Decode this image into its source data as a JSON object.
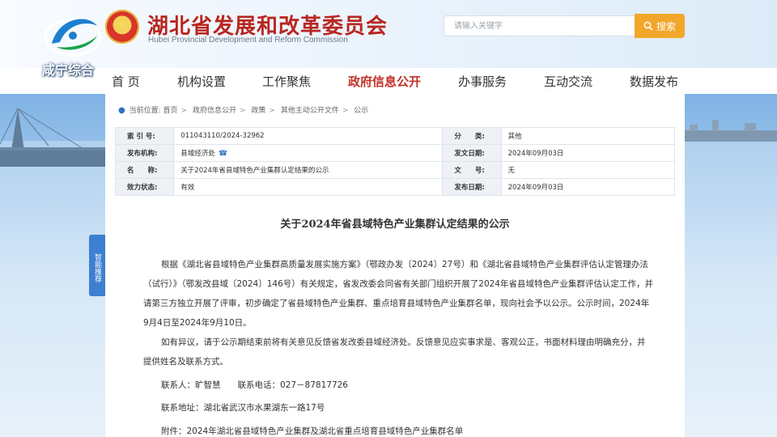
{
  "header": {
    "title": "湖北省发展和改革委员会",
    "subtitle": "Hubei Provincial Development and Reform Commission",
    "search_placeholder": "请输入关键字",
    "search_button": "搜索"
  },
  "channel": {
    "name": "咸宁综合"
  },
  "nav": {
    "items": [
      "首 页",
      "机构设置",
      "工作聚焦",
      "政府信息公开",
      "办事服务",
      "互动交流",
      "数据发布"
    ],
    "active_index": 3
  },
  "breadcrumb": {
    "prefix": "当前位置:",
    "items": [
      "首页",
      "政府信息公开",
      "政策",
      "其他主动公开文件",
      "公示"
    ]
  },
  "side_tab": {
    "label": "智能推荐"
  },
  "meta": {
    "index_label": "索 引 号:",
    "index_value": "011043110/2024-32962",
    "category_label": "分　　类:",
    "category_value": "其他",
    "publisher_label": "发布机构:",
    "publisher_value": "县域经济处",
    "issue_date_label": "发文日期:",
    "issue_date_value": "2024年09月03日",
    "name_label": "名　　称:",
    "name_value": "关于2024年省县域特色产业集群认定结果的公示",
    "doc_no_label": "文　　号:",
    "doc_no_value": "无",
    "status_label": "效力状态:",
    "status_value": "有效",
    "publish_date_label": "发布日期:",
    "publish_date_value": "2024年09月03日"
  },
  "article": {
    "title": "关于2024年省县域特色产业集群认定结果的公示",
    "para1": "根据《湖北省县域特色产业集群高质量发展实施方案》（鄂政办发〔2024〕27号）和《湖北省县域特色产业集群评估认定管理办法（试行）》（鄂发改县域〔2024〕146号）有关规定，省发改委会同省有关部门组织开展了2024年省县域特色产业集群评估认定工作，并请第三方独立开展了评审，初步确定了省县域特色产业集群、重点培育县域特色产业集群名单，现向社会予以公示。公示时间，2024年9月4日至2024年9月10日。",
    "para2": "如有异议，请于公示期结束前将有关意见反馈省发改委县域经济处。反馈意见应实事求是、客观公正，书面材料理由明确充分，并提供姓名及联系方式。",
    "contact": "联系人：旷智慧　　联系电话：027－87817726",
    "address": "联系地址：湖北省武汉市水果湖东一路17号",
    "attachment": "附件：2024年湖北省县域特色产业集群及湖北省重点培育县域特色产业集群名单"
  },
  "colors": {
    "brand_red": "#c2312a",
    "accent_orange": "#f2a62a",
    "link_blue": "#2f6fc2"
  }
}
